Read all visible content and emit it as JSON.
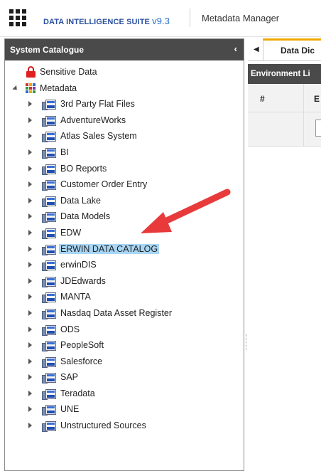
{
  "header": {
    "brand": "DATA INTELLIGENCE SUITE",
    "version": "v9.3",
    "module": "Metadata Manager"
  },
  "left_panel": {
    "title": "System Catalogue",
    "collapse_glyph": "‹",
    "sensitive_label": "Sensitive Data",
    "metadata_label": "Metadata",
    "items": [
      {
        "label": "3rd Party Flat Files"
      },
      {
        "label": "AdventureWorks"
      },
      {
        "label": "Atlas Sales System"
      },
      {
        "label": "BI"
      },
      {
        "label": "BO Reports"
      },
      {
        "label": "Customer Order Entry"
      },
      {
        "label": "Data Lake"
      },
      {
        "label": "Data Models"
      },
      {
        "label": "EDW"
      },
      {
        "label": "ERWIN DATA CATALOG",
        "selected": true
      },
      {
        "label": "erwinDIS"
      },
      {
        "label": "JDEdwards"
      },
      {
        "label": "MANTA"
      },
      {
        "label": "Nasdaq Data Asset Register"
      },
      {
        "label": "ODS"
      },
      {
        "label": "PeopleSoft"
      },
      {
        "label": "Salesforce"
      },
      {
        "label": "SAP"
      },
      {
        "label": "Teradata"
      },
      {
        "label": "UNE"
      },
      {
        "label": "Unstructured Sources"
      }
    ]
  },
  "right_panel": {
    "tab_scroll_glyph": "◀",
    "tab_label": "Data Dic",
    "section_title": "Environment Li",
    "columns": [
      "#",
      "E"
    ]
  },
  "colors": {
    "header_bg": "#4a4a4a",
    "brand": "#2a4fa0",
    "tab_accent": "#f0a800",
    "selected_bg": "#a8d6f5",
    "arrow": "#e83a3a"
  },
  "icons": {
    "app_menu": "grid-menu-icon",
    "sensitive": "lock-icon",
    "metadata": "metadata-grid-icon",
    "item": "database-system-icon"
  }
}
